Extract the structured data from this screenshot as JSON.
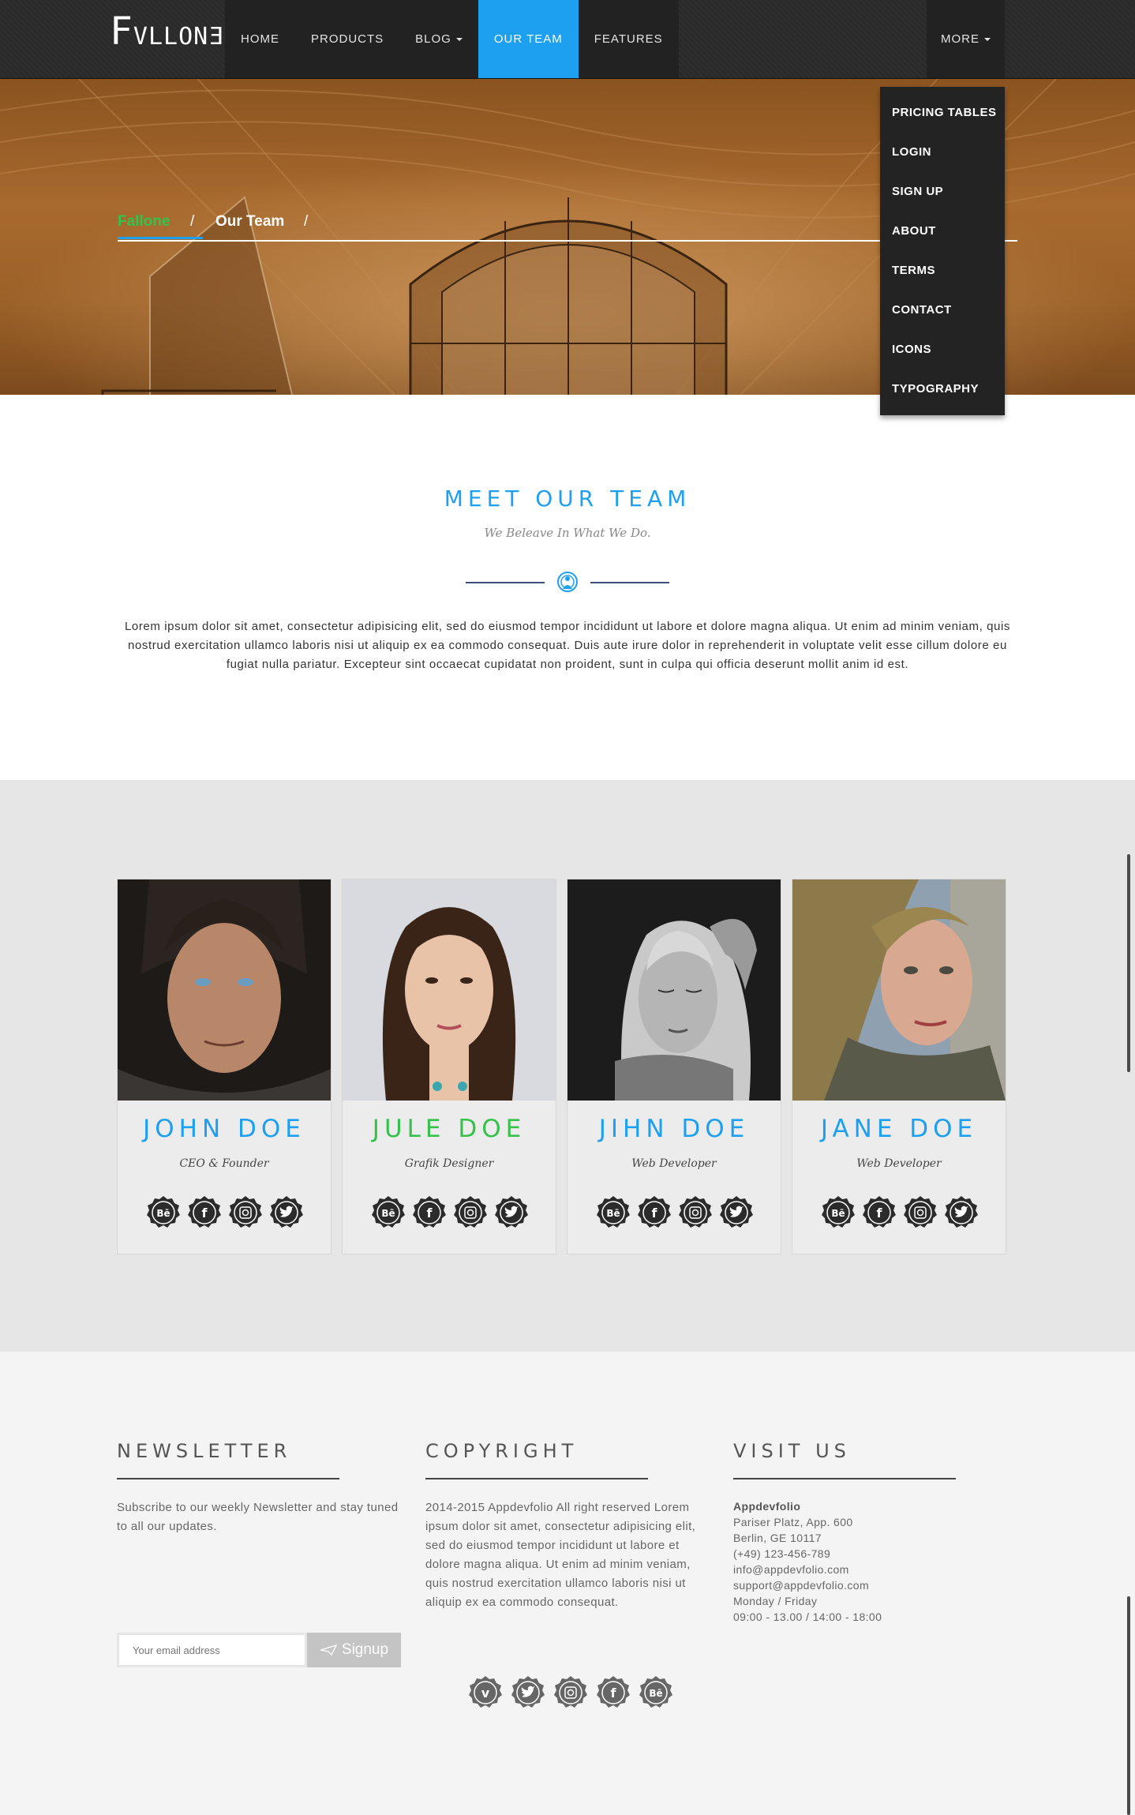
{
  "nav": {
    "logo": {
      "first": "F",
      "rest": "VLLON",
      "last": "Ǝ"
    },
    "items": [
      {
        "label": "HOME",
        "active": false,
        "caret": false
      },
      {
        "label": "PRODUCTS",
        "active": false,
        "caret": false
      },
      {
        "label": "BLOG",
        "active": false,
        "caret": true
      },
      {
        "label": "OUR TEAM",
        "active": true,
        "caret": false
      },
      {
        "label": "FEATURES",
        "active": false,
        "caret": false
      }
    ],
    "more_label": "MORE",
    "dropdown": [
      "PRICING TABLES",
      "LOGIN",
      "SIGN UP",
      "ABOUT",
      "TERMS",
      "CONTACT",
      "ICONS",
      "TYPOGRAPHY"
    ]
  },
  "breadcrumb": {
    "home": "Fallone",
    "separator": "/",
    "current": "Our Team"
  },
  "intro": {
    "title": "MEET OUR TEAM",
    "subtitle": "We Beleave In What We Do.",
    "text": "Lorem ipsum dolor sit amet, consectetur adipisicing elit, sed do eiusmod tempor incididunt ut labore et dolore magna aliqua. Ut enim ad minim veniam, quis nostrud exercitation ullamco laboris nisi ut aliquip ex ea commodo consequat. Duis aute irure dolor in reprehenderit in voluptate velit esse cillum dolore eu fugiat nulla pariatur. Excepteur sint occaecat cupidatat non proident, sunt in culpa qui officia deserunt mollit anim id est."
  },
  "team": [
    {
      "name": "JOHN DOE",
      "role": "CEO & Founder",
      "name_color": "#1ea0f0"
    },
    {
      "name": "JULE DOE",
      "role": "Grafik Designer",
      "name_color": "#35c24a"
    },
    {
      "name": "JIHN DOE",
      "role": "Web Developer",
      "name_color": "#1ea0f0"
    },
    {
      "name": "JANE DOE",
      "role": "Web Developer",
      "name_color": "#1ea0f0"
    }
  ],
  "member_socials": [
    "behance-icon",
    "facebook-icon",
    "instagram-icon",
    "twitter-icon"
  ],
  "footer": {
    "newsletter": {
      "title": "NEWSLETTER",
      "text": "Subscribe to our weekly Newsletter and stay tuned to all our updates.",
      "placeholder": "Your email address",
      "button": "Signup"
    },
    "copyright": {
      "title": "COPYRIGHT",
      "text": "2014-2015 Appdevfolio All right reserved Lorem ipsum dolor sit amet, consectetur adipisicing elit, sed do eiusmod tempor incididunt ut labore et dolore magna aliqua. Ut enim ad minim veniam, quis nostrud exercitation ullamco laboris nisi ut aliquip ex ea commodo consequat."
    },
    "visit": {
      "title": "VISIT US",
      "company": "Appdevfolio",
      "lines": [
        "Pariser Platz, App. 600",
        "Berlin, GE 10117",
        "(+49) 123-456-789",
        "info@appdevfolio.com",
        "support@appdevfolio.com",
        "Monday / Friday",
        "09:00 - 13.00 / 14:00 - 18:00"
      ]
    },
    "socials": [
      "vimeo-icon",
      "twitter-icon",
      "instagram-icon",
      "facebook-icon",
      "behance-icon"
    ]
  },
  "colors": {
    "accent": "#1ea0f0",
    "green": "#35c24a",
    "nav_bg": "#2a2a2a",
    "badge": "#2b2b2b",
    "footer_badge": "#666666"
  }
}
